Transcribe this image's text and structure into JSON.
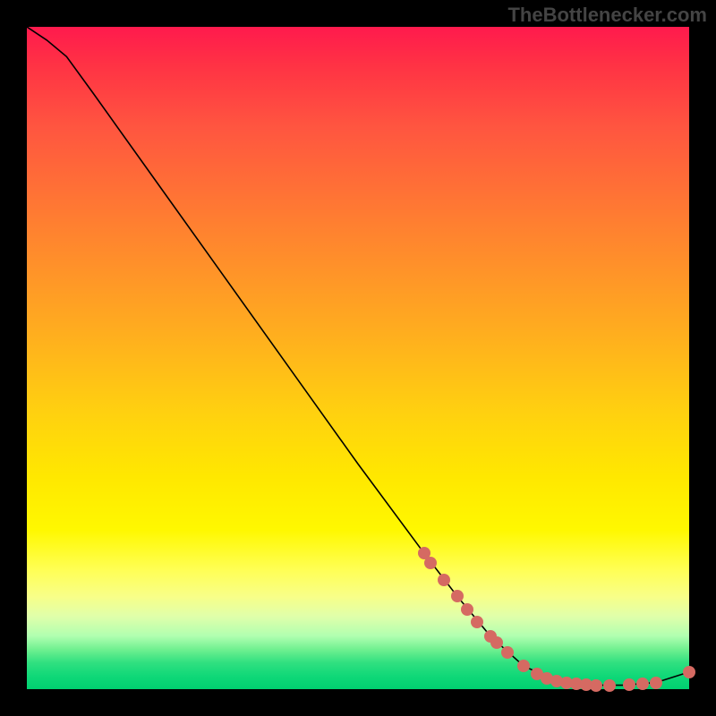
{
  "watermark": "TheBottlenecker.com",
  "chart_data": {
    "type": "line",
    "title": "",
    "xlabel": "",
    "ylabel": "",
    "xlim": [
      0,
      100
    ],
    "ylim": [
      0,
      100
    ],
    "curve": [
      {
        "x": 0,
        "y": 100
      },
      {
        "x": 3,
        "y": 98
      },
      {
        "x": 6,
        "y": 95.5
      },
      {
        "x": 10,
        "y": 90
      },
      {
        "x": 20,
        "y": 76
      },
      {
        "x": 30,
        "y": 62
      },
      {
        "x": 40,
        "y": 48
      },
      {
        "x": 50,
        "y": 34
      },
      {
        "x": 60,
        "y": 20.5
      },
      {
        "x": 65,
        "y": 14
      },
      {
        "x": 70,
        "y": 8
      },
      {
        "x": 75,
        "y": 3.5
      },
      {
        "x": 80,
        "y": 1.2
      },
      {
        "x": 85,
        "y": 0.6
      },
      {
        "x": 90,
        "y": 0.6
      },
      {
        "x": 95,
        "y": 1.0
      },
      {
        "x": 100,
        "y": 2.6
      }
    ],
    "points": [
      {
        "x": 60,
        "y": 20.5
      },
      {
        "x": 61,
        "y": 19
      },
      {
        "x": 63,
        "y": 16.5
      },
      {
        "x": 65,
        "y": 14
      },
      {
        "x": 66.5,
        "y": 12
      },
      {
        "x": 68,
        "y": 10.2
      },
      {
        "x": 70,
        "y": 8
      },
      {
        "x": 71,
        "y": 7
      },
      {
        "x": 72.5,
        "y": 5.5
      },
      {
        "x": 75,
        "y": 3.5
      },
      {
        "x": 77,
        "y": 2.3
      },
      {
        "x": 78.5,
        "y": 1.6
      },
      {
        "x": 80,
        "y": 1.2
      },
      {
        "x": 81.5,
        "y": 1.0
      },
      {
        "x": 83,
        "y": 0.8
      },
      {
        "x": 84.5,
        "y": 0.7
      },
      {
        "x": 86,
        "y": 0.6
      },
      {
        "x": 88,
        "y": 0.6
      },
      {
        "x": 91,
        "y": 0.7
      },
      {
        "x": 93,
        "y": 0.8
      },
      {
        "x": 95,
        "y": 1.0
      },
      {
        "x": 100,
        "y": 2.6
      }
    ]
  }
}
